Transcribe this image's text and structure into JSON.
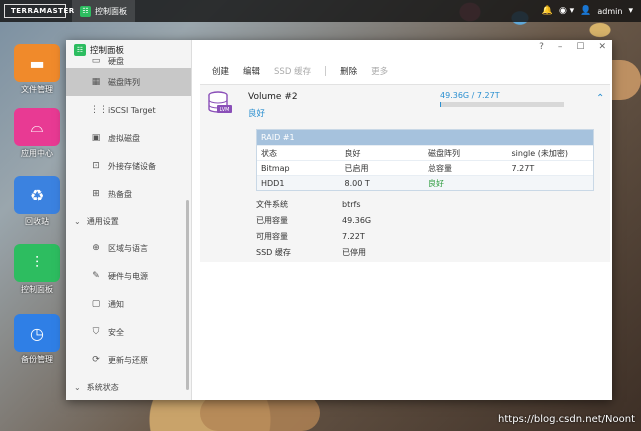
{
  "topbar": {
    "brand": "TERRAMASTER",
    "app_label": "控制面板",
    "user": "admin"
  },
  "desktop": {
    "icons": [
      {
        "label": "文件管理",
        "color": "#f08a2b",
        "icon": "folder-icon"
      },
      {
        "label": "应用中心",
        "color": "#e83a93",
        "icon": "shopping-bag-icon"
      },
      {
        "label": "回收站",
        "color": "#3b82e0",
        "icon": "recycle-bin-icon"
      },
      {
        "label": "控制面板",
        "color": "#2dbd60",
        "icon": "sliders-icon"
      },
      {
        "label": "备份管理",
        "color": "#2f7fe6",
        "icon": "backup-clock-icon"
      }
    ],
    "watermark": "https://blog.csdn.net/Noont"
  },
  "sidebar": {
    "title": "控制面板",
    "items_top": [
      {
        "label": "硬盘",
        "icon": "disk-icon"
      },
      {
        "label": "磁盘阵列",
        "icon": "raid-icon",
        "active": true
      },
      {
        "label": "iSCSI Target",
        "icon": "iscsi-icon"
      },
      {
        "label": "虚拟磁盘",
        "icon": "virtual-disk-icon"
      },
      {
        "label": "外接存储设备",
        "icon": "usb-storage-icon"
      },
      {
        "label": "热备盘",
        "icon": "hot-spare-icon"
      }
    ],
    "group_general": "通用设置",
    "items_general": [
      {
        "label": "区域与语言",
        "icon": "globe-icon"
      },
      {
        "label": "硬件与电源",
        "icon": "wrench-icon"
      },
      {
        "label": "通知",
        "icon": "notification-icon"
      },
      {
        "label": "安全",
        "icon": "shield-icon"
      },
      {
        "label": "更新与还原",
        "icon": "update-icon"
      }
    ],
    "group_status": "系统状态"
  },
  "toolbar": {
    "create": "创建",
    "edit": "编辑",
    "ssd_cache": "SSD 缓存",
    "delete": "删除",
    "more": "更多"
  },
  "volume": {
    "name": "Volume #2",
    "status": "良好",
    "badge": "LVM",
    "capacity_text": "49.36G / 7.27T",
    "used_fraction": 0.007
  },
  "raid": {
    "title": "RAID #1",
    "rows": [
      [
        "状态",
        "良好",
        "磁盘阵列",
        "single (未加密)"
      ],
      [
        "Bitmap",
        "已启用",
        "总容量",
        "7.27T"
      ],
      [
        "HDD1",
        "8.00 T",
        "良好",
        ""
      ]
    ]
  },
  "info": [
    {
      "k": "文件系统",
      "v": "btrfs"
    },
    {
      "k": "已用容量",
      "v": "49.36G"
    },
    {
      "k": "可用容量",
      "v": "7.22T"
    },
    {
      "k": "SSD 缓存",
      "v": "已停用"
    }
  ]
}
